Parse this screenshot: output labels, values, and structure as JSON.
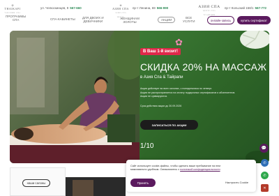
{
  "header": {
    "left_logo": {
      "name": "THAIKAPI",
      "sub": "ТАЙСКИЙ СПА"
    },
    "left_address": "ул. Челюскинцев, 9",
    "left_phone": "567-660",
    "center_logo": {
      "name": "АЗИЯ СПА",
      "sub": "АЗИЯ СПА ЦЕНТР"
    },
    "center_address": "пр-т Ленина, 69",
    "center_phone": "566-990",
    "right_logo": {
      "name": "АЗИЯ СПА",
      "sub": "ЦЕНТР СПА ТРАДИЦИЙ"
    },
    "right_address": "пр-т Кольский 158/1",
    "right_phone": "567-772"
  },
  "nav": {
    "items": [
      {
        "line1": "ПРОГРАММЫ",
        "line2": "СПА"
      },
      {
        "line1": "СПА-КАБИНЕТЫ",
        "line2": ""
      },
      {
        "line1": "ДЛЯ ДВОИХ И",
        "line2": "ДЕВИЧНИКИ"
      },
      {
        "line1": "ЖЕНЩИНАМ ЗОЛОТЫ",
        "line2": ""
      },
      {
        "line1": "АКЦИИ",
        "line2": ""
      },
      {
        "line1": "ВСЕ",
        "line2": "УСЛУГИ"
      }
    ],
    "online_booking": "онлайн-запись",
    "buy_certificate": "купить сертификат"
  },
  "hero": {
    "badge": "В Ваш 1-й визит!",
    "title": "СКИДКА 20% НА МАССАЖ",
    "subtitle": "в Азия Спа & Тайрапи",
    "desc_lines": [
      "Акция действует во всех салонах, с понедельника по четверг.",
      "Акция не распространяется на оплату подарочных сертификатов и абонементов.",
      "Акции не суммируются."
    ],
    "valid": "Срок действия акции до 30.09.2026",
    "cta": "записаться по акции",
    "pager": "1/10"
  },
  "below": {
    "our_salons": "наши салоны"
  },
  "cookie": {
    "text_line1": "Сайт использует cookie-файлы, чтобы сделать ваше пребывание на нем",
    "text_line2": "максимально удобным. Ознакомьтесь с",
    "link": "политикой конфиденциальности",
    "accept": "Принять",
    "settings": "Настроить Cookie"
  },
  "colors": {
    "brand_purple": "#5b1a5e",
    "hero_green": "#2f6a2b",
    "accent_red": "#e0284a",
    "phone_green": "#2e8b57"
  }
}
